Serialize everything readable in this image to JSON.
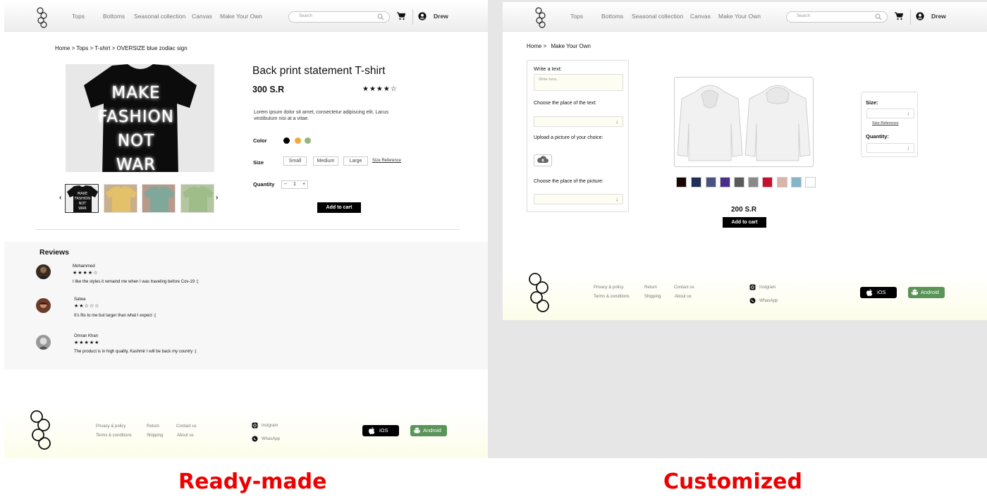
{
  "header": {
    "nav": [
      "Tops",
      "Bottoms",
      "Seasonal collection",
      "Canvas",
      "Make Your Own"
    ],
    "search_placeholder": "Search",
    "user_name": "Drew"
  },
  "product_page": {
    "breadcrumb": [
      "Home",
      ">",
      "Tops",
      ">",
      "T-shirt",
      ">",
      "OVERSIZE blue zodiac sign"
    ],
    "image_text": [
      "MAKE",
      "FASHION",
      "NOT",
      "WAR"
    ],
    "title": "Back print statement T-shirt",
    "price": "300 S.R",
    "rating_stars": "★★★★☆",
    "description": "Lorem ipsum dolor sit amet, consectetur adipiscing elit. Lacus vestibulum nisi at a vitae.",
    "color_label": "Color",
    "colors": [
      "#000000",
      "#f2a93b",
      "#95b87a"
    ],
    "size_label": "Size",
    "sizes": [
      "Small",
      "Medium",
      "Large"
    ],
    "size_reference": "Size Reference",
    "quantity_label": "Quantity",
    "quantity_minus": "−",
    "quantity_value": "1",
    "quantity_plus": "+",
    "add_to_cart": "Add to cart",
    "prev_arrow": "‹",
    "next_arrow": "›",
    "thumbnail_colors": [
      "#111111",
      "#e3c06a",
      "#7fa89a",
      "#9ebd88"
    ]
  },
  "reviews": {
    "title": "Reviews",
    "items": [
      {
        "name": "Mohammed",
        "stars": "★★★★☆",
        "text": "I like the styles it remaind me when I was traveling before Cov-19 :("
      },
      {
        "name": "Salwa",
        "stars": "★★☆☆☆",
        "text": "It's fits to me but larger than what I expect :("
      },
      {
        "name": "Omran Khan",
        "stars": "★★★★★",
        "text": "The product is in high quality, Kashmir I will be back my country :("
      }
    ]
  },
  "footer": {
    "links_col1": [
      "Privacy & policy",
      "Terms & conditions"
    ],
    "links_col2": [
      "Return",
      "Shipping"
    ],
    "links_col3": [
      "Contact us",
      "About us"
    ],
    "social": [
      "Instgram",
      "WhasApp"
    ],
    "ios_label": "iOS",
    "android_label": "Android"
  },
  "custom_page": {
    "breadcrumb": [
      "Home",
      ">",
      "Make Your Own"
    ],
    "write_text_label": "Write a text:",
    "write_text_placeholder": "Write here..",
    "place_text_label": "Choose the place of the text:",
    "upload_label": "Upload a picture of your choice:",
    "place_picture_label": "Choose the place of the picture:",
    "swatches": [
      "#1a0505",
      "#1f2f55",
      "#4a5280",
      "#4a2f8a",
      "#5a5a5a",
      "#8a8a8a",
      "#c8102e",
      "#d9b4a8",
      "#86b5c9",
      "#ffffff"
    ],
    "price": "200 S.R",
    "add_to_cart": "Add to cart",
    "size_label": "Size:",
    "size_reference": "Size Reference",
    "quantity_label": "Quantity:"
  },
  "captions": {
    "left": "Ready-made",
    "right": "Customized"
  },
  "icons": [
    "logo",
    "search-icon",
    "cart-icon",
    "user-icon",
    "chevron-left-icon",
    "chevron-right-icon",
    "instagram-icon",
    "whatsapp-icon",
    "apple-icon",
    "android-icon",
    "cloud-upload-icon",
    "chevron-down-icon"
  ]
}
